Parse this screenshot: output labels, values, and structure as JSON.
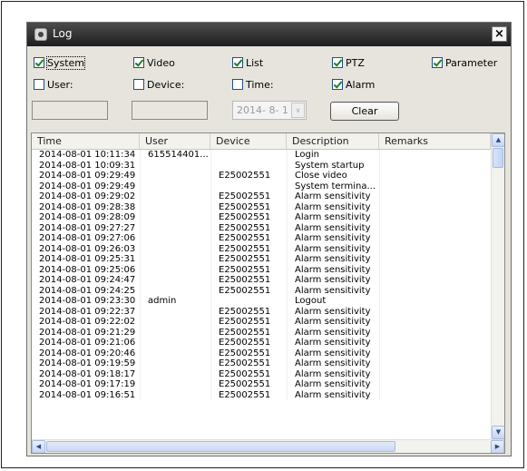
{
  "window": {
    "title": "Log",
    "close_glyph": "×"
  },
  "filters": {
    "row1": [
      "System",
      "Video",
      "List",
      "PTZ",
      "Parameter"
    ],
    "row2": [
      "User:",
      "Device:",
      "Time:",
      "Alarm"
    ],
    "date_value": "2014- 8- 1",
    "date_dropdown_glyph": "∨",
    "clear_label": "Clear"
  },
  "table": {
    "columns": [
      "Time",
      "User",
      "Device",
      "Description",
      "Remarks"
    ],
    "rows": [
      [
        "2014-08-01 10:11:34",
        "615514401...",
        "",
        "Login",
        ""
      ],
      [
        "2014-08-01 10:09:31",
        "",
        "",
        "System startup",
        ""
      ],
      [
        "2014-08-01 09:29:49",
        "",
        "E25002551",
        "Close video",
        ""
      ],
      [
        "2014-08-01 09:29:49",
        "",
        "",
        "System termina...",
        ""
      ],
      [
        "2014-08-01 09:29:02",
        "",
        "E25002551",
        "Alarm sensitivity",
        ""
      ],
      [
        "2014-08-01 09:28:38",
        "",
        "E25002551",
        "Alarm sensitivity",
        ""
      ],
      [
        "2014-08-01 09:28:09",
        "",
        "E25002551",
        "Alarm sensitivity",
        ""
      ],
      [
        "2014-08-01 09:27:27",
        "",
        "E25002551",
        "Alarm sensitivity",
        ""
      ],
      [
        "2014-08-01 09:27:06",
        "",
        "E25002551",
        "Alarm sensitivity",
        ""
      ],
      [
        "2014-08-01 09:26:03",
        "",
        "E25002551",
        "Alarm sensitivity",
        ""
      ],
      [
        "2014-08-01 09:25:31",
        "",
        "E25002551",
        "Alarm sensitivity",
        ""
      ],
      [
        "2014-08-01 09:25:06",
        "",
        "E25002551",
        "Alarm sensitivity",
        ""
      ],
      [
        "2014-08-01 09:24:47",
        "",
        "E25002551",
        "Alarm sensitivity",
        ""
      ],
      [
        "2014-08-01 09:24:25",
        "",
        "E25002551",
        "Alarm sensitivity",
        ""
      ],
      [
        "2014-08-01 09:23:30",
        "admin",
        "",
        "Logout",
        ""
      ],
      [
        "2014-08-01 09:22:37",
        "",
        "E25002551",
        "Alarm sensitivity",
        ""
      ],
      [
        "2014-08-01 09:22:02",
        "",
        "E25002551",
        "Alarm sensitivity",
        ""
      ],
      [
        "2014-08-01 09:21:29",
        "",
        "E25002551",
        "Alarm sensitivity",
        ""
      ],
      [
        "2014-08-01 09:21:06",
        "",
        "E25002551",
        "Alarm sensitivity",
        ""
      ],
      [
        "2014-08-01 09:20:46",
        "",
        "E25002551",
        "Alarm sensitivity",
        ""
      ],
      [
        "2014-08-01 09:19:59",
        "",
        "E25002551",
        "Alarm sensitivity",
        ""
      ],
      [
        "2014-08-01 09:18:17",
        "",
        "E25002551",
        "Alarm sensitivity",
        ""
      ],
      [
        "2014-08-01 09:17:19",
        "",
        "E25002551",
        "Alarm sensitivity",
        ""
      ],
      [
        "2014-08-01 09:16:51",
        "",
        "E25002551",
        "Alarm sensitivity",
        ""
      ]
    ]
  },
  "scrollbars": {
    "up": "▲",
    "down": "▼",
    "left": "◀",
    "right": "▶"
  }
}
